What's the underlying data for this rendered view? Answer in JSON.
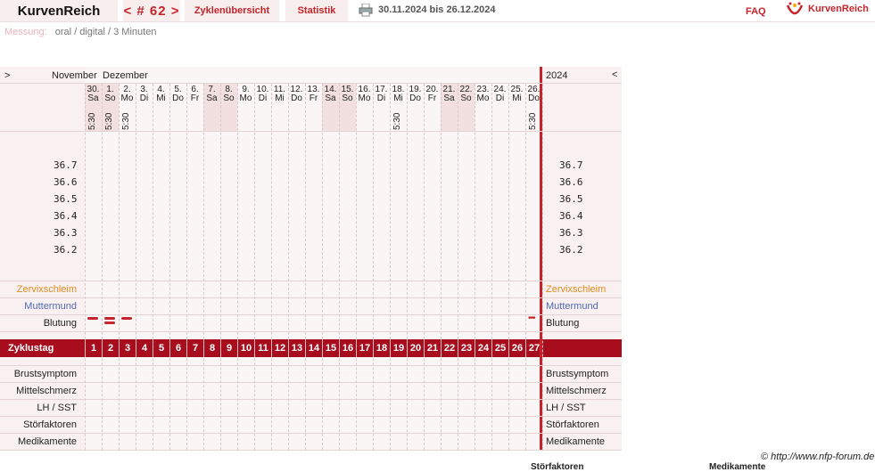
{
  "topbar": {
    "brand": "KurvenReich",
    "nav": "< # 62 >",
    "cycle_overview": "Zyklenübersicht",
    "statistics": "Statistik",
    "date_range": "30.11.2024 bis 26.12.2024",
    "faq": "FAQ",
    "logo_text": "KurvenReich"
  },
  "measurement": {
    "label": "Messung:",
    "value": "oral / digital / 3 Minuten"
  },
  "chart": {
    "nav_left": ">",
    "nav_right": "<",
    "month1": "November",
    "month2": "Dezember",
    "year": "2024",
    "days": [
      {
        "n": "30.",
        "d": "Sa",
        "t": "5:30",
        "we": true
      },
      {
        "n": "1.",
        "d": "So",
        "t": "5:30",
        "we": true
      },
      {
        "n": "2.",
        "d": "Mo",
        "t": "5:30",
        "we": false
      },
      {
        "n": "3.",
        "d": "Di",
        "t": "",
        "we": false
      },
      {
        "n": "4.",
        "d": "Mi",
        "t": "",
        "we": false
      },
      {
        "n": "5.",
        "d": "Do",
        "t": "",
        "we": false
      },
      {
        "n": "6.",
        "d": "Fr",
        "t": "",
        "we": false
      },
      {
        "n": "7.",
        "d": "Sa",
        "t": "",
        "we": true
      },
      {
        "n": "8.",
        "d": "So",
        "t": "",
        "we": true
      },
      {
        "n": "9.",
        "d": "Mo",
        "t": "",
        "we": false
      },
      {
        "n": "10.",
        "d": "Di",
        "t": "",
        "we": false
      },
      {
        "n": "11.",
        "d": "Mi",
        "t": "",
        "we": false
      },
      {
        "n": "12.",
        "d": "Do",
        "t": "",
        "we": false
      },
      {
        "n": "13.",
        "d": "Fr",
        "t": "",
        "we": false
      },
      {
        "n": "14.",
        "d": "Sa",
        "t": "",
        "we": true
      },
      {
        "n": "15.",
        "d": "So",
        "t": "",
        "we": true
      },
      {
        "n": "16.",
        "d": "Mo",
        "t": "",
        "we": false
      },
      {
        "n": "17.",
        "d": "Di",
        "t": "",
        "we": false
      },
      {
        "n": "18.",
        "d": "Mi",
        "t": "5:30",
        "we": false
      },
      {
        "n": "19.",
        "d": "Do",
        "t": "",
        "we": false
      },
      {
        "n": "20.",
        "d": "Fr",
        "t": "",
        "we": false
      },
      {
        "n": "21.",
        "d": "Sa",
        "t": "",
        "we": true
      },
      {
        "n": "22.",
        "d": "So",
        "t": "",
        "we": true
      },
      {
        "n": "23.",
        "d": "Mo",
        "t": "",
        "we": false
      },
      {
        "n": "24.",
        "d": "Di",
        "t": "",
        "we": false
      },
      {
        "n": "25.",
        "d": "Mi",
        "t": "",
        "we": false
      },
      {
        "n": "26.",
        "d": "Do",
        "t": "5:30",
        "we": false
      }
    ],
    "temp_scale": [
      "36.7",
      "36.6",
      "36.5",
      "36.4",
      "36.3",
      "36.2"
    ],
    "rows_left": {
      "cervical": "Zervixschleim",
      "cervix": "Muttermund",
      "bleeding": "Blutung",
      "cycle_day": "Zyklustag",
      "breast": "Brustsymptom",
      "midpain": "Mittelschmerz",
      "lh": "LH / SST",
      "disturb": "Störfaktoren",
      "meds": "Medikamente"
    },
    "cycle_days": [
      "1",
      "2",
      "3",
      "4",
      "5",
      "6",
      "7",
      "8",
      "9",
      "10",
      "11",
      "12",
      "13",
      "14",
      "15",
      "16",
      "17",
      "18",
      "19",
      "20",
      "21",
      "22",
      "23",
      "24",
      "25",
      "26",
      "27"
    ],
    "colors": {
      "accent": "#c5242b",
      "cycle_bar": "#a80d1e",
      "cervical": "#e38b1e",
      "cervix": "#4e69b3"
    }
  },
  "footer": {
    "copyright": "© http://www.nfp-forum.de",
    "bottom1": "Störfaktoren",
    "bottom2": "Medikamente"
  }
}
